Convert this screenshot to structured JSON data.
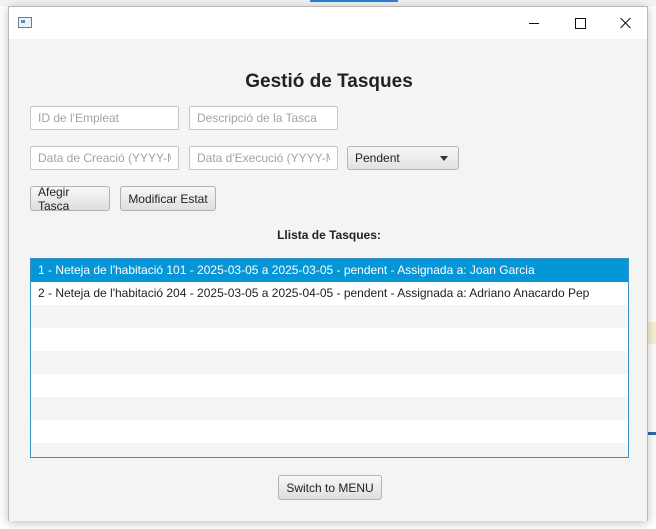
{
  "window": {
    "title": ""
  },
  "form": {
    "heading": "Gestió de Tasques",
    "employee_id_placeholder": "ID de l'Empleat",
    "description_placeholder": "Descripció de la Tasca",
    "creation_date_placeholder": "Data de Creació (YYYY-MM-DD)",
    "execution_date_placeholder": "Data d'Execució (YYYY-MM-DD)",
    "status_selected": "Pendent",
    "add_button": "Afegir Tasca",
    "modify_button": "Modificar Estat"
  },
  "task_list": {
    "label": "Llista de Tasques:",
    "items": [
      "1 - Neteja de l'habitació 101 - 2025-03-05 a 2025-03-05 - pendent - Assignada a: Joan Garcia",
      "2 - Neteja de l'habitació 204 - 2025-03-05 a 2025-04-05 - pendent - Assignada a: Adriano Anacardo Pep"
    ],
    "selected_index": 0
  },
  "footer": {
    "switch_button": "Switch to MENU"
  }
}
